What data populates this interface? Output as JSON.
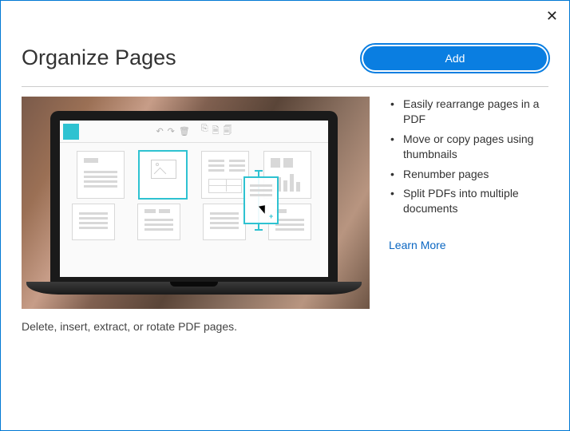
{
  "header": {
    "title": "Organize Pages",
    "add_label": "Add"
  },
  "caption": "Delete, insert, extract, or rotate PDF pages.",
  "features": [
    "Easily rearrange pages in a PDF",
    "Move or copy pages using thumbnails",
    "Renumber pages",
    "Split PDFs into multiple documents"
  ],
  "learn_more": "Learn More"
}
